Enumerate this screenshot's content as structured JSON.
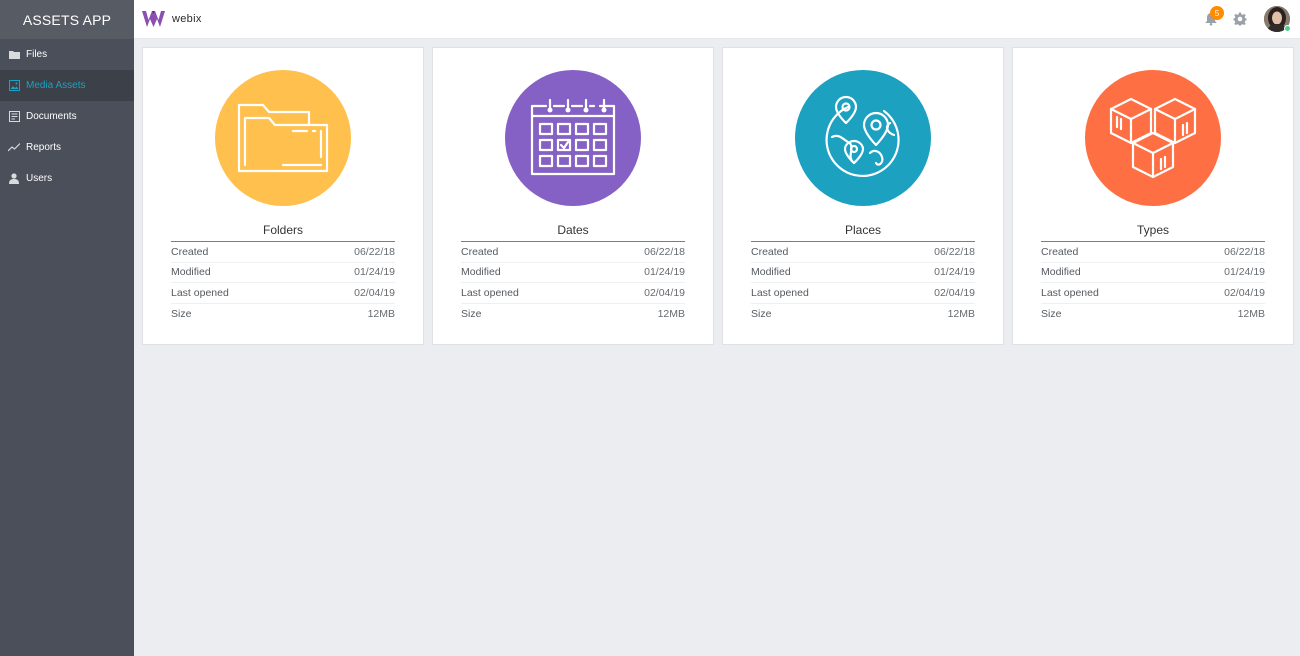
{
  "app": {
    "title": "ASSETS APP",
    "brand": "webix"
  },
  "sidebar": {
    "items": [
      {
        "label": "Files",
        "icon": "folder-icon",
        "active": false
      },
      {
        "label": "Media Assets",
        "icon": "image-icon",
        "active": true
      },
      {
        "label": "Documents",
        "icon": "document-icon",
        "active": false
      },
      {
        "label": "Reports",
        "icon": "chart-line-icon",
        "active": false
      },
      {
        "label": "Users",
        "icon": "user-icon",
        "active": false
      }
    ]
  },
  "header": {
    "notifications_count": "5"
  },
  "colors": {
    "accent": "#1ca1c1",
    "sidebar_bg": "#4a4f59",
    "folders": "#ffc04d",
    "dates": "#8661c5",
    "places": "#1ca1c1",
    "types": "#ff6f44",
    "badge": "#ff8c00"
  },
  "cards": [
    {
      "title": "Folders",
      "icon": "folder-icon",
      "rows": [
        {
          "label": "Created",
          "value": "06/22/18"
        },
        {
          "label": "Modified",
          "value": "01/24/19"
        },
        {
          "label": "Last opened",
          "value": "02/04/19"
        },
        {
          "label": "Size",
          "value": "12MB"
        }
      ]
    },
    {
      "title": "Dates",
      "icon": "calendar-icon",
      "rows": [
        {
          "label": "Created",
          "value": "06/22/18"
        },
        {
          "label": "Modified",
          "value": "01/24/19"
        },
        {
          "label": "Last opened",
          "value": "02/04/19"
        },
        {
          "label": "Size",
          "value": "12MB"
        }
      ]
    },
    {
      "title": "Places",
      "icon": "globe-pins-icon",
      "rows": [
        {
          "label": "Created",
          "value": "06/22/18"
        },
        {
          "label": "Modified",
          "value": "01/24/19"
        },
        {
          "label": "Last opened",
          "value": "02/04/19"
        },
        {
          "label": "Size",
          "value": "12MB"
        }
      ]
    },
    {
      "title": "Types",
      "icon": "cubes-icon",
      "rows": [
        {
          "label": "Created",
          "value": "06/22/18"
        },
        {
          "label": "Modified",
          "value": "01/24/19"
        },
        {
          "label": "Last opened",
          "value": "02/04/19"
        },
        {
          "label": "Size",
          "value": "12MB"
        }
      ]
    }
  ]
}
